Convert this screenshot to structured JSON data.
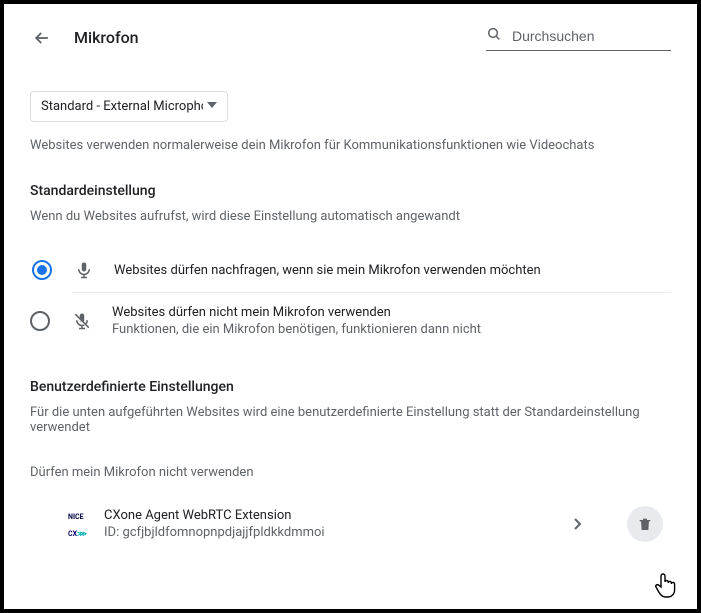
{
  "header": {
    "title": "Mikrofon",
    "search_placeholder": "Durchsuchen"
  },
  "device_select": {
    "label": "Standard - External Microphone"
  },
  "intro": "Websites verwenden normalerweise dein Mikrofon für Kommunikationsfunktionen wie Videochats",
  "default_section": {
    "heading": "Standardeinstellung",
    "sub": "Wenn du Websites aufrufst, wird diese Einstellung automatisch angewandt",
    "options": [
      {
        "label": "Websites dürfen nachfragen, wenn sie mein Mikrofon verwenden möchten",
        "selected": true
      },
      {
        "label": "Websites dürfen nicht mein Mikrofon verwenden",
        "sub": "Funktionen, die ein Mikrofon benötigen, funktionieren dann nicht",
        "selected": false
      }
    ]
  },
  "custom_section": {
    "heading": "Benutzerdefinierte Einstellungen",
    "sub": "Für die unten aufgeführten Websites wird eine benutzerdefinierte Einstellung statt der Standardeinstellung verwendet",
    "blocked_heading": "Dürfen mein Mikrofon nicht verwenden",
    "sites": [
      {
        "name": "CXone Agent WebRTC Extension",
        "id_label": "ID: gcfjbjldfomnopnpdjajjfpldkkdmmoi"
      }
    ]
  }
}
